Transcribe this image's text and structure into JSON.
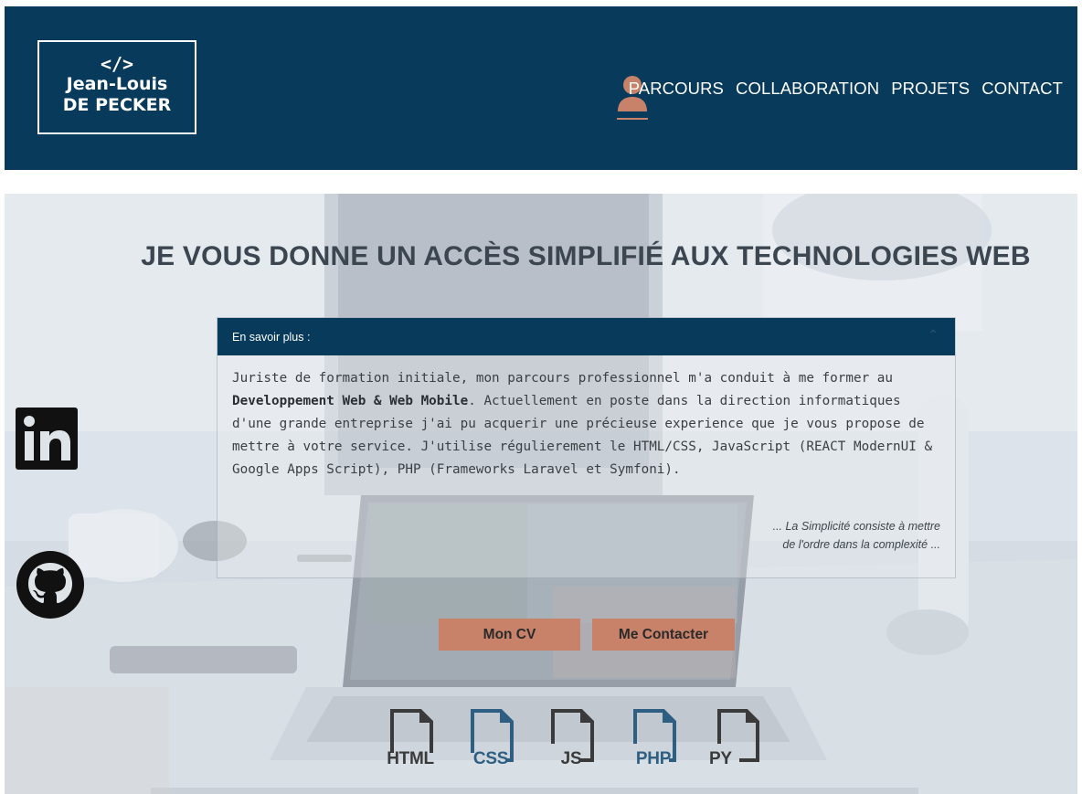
{
  "header": {
    "logo_code": "</>",
    "logo_name_line1": "Jean-Louis",
    "logo_name_line2": "DE PECKER",
    "nav": [
      "PARCOURS",
      "COLLABORATION",
      "PROJETS",
      "CONTACT"
    ],
    "profile_icon": "user-icon"
  },
  "hero": {
    "headline": "JE VOUS DONNE UN ACCÈS SIMPLIFIÉ AUX TECHNOLOGIES WEB",
    "panel": {
      "title": "En savoir plus :",
      "body_part1": "Juriste de formation initiale, mon parcours professionnel m'a conduit à me former au",
      "body_bold": "Developpement Web & Web Mobile",
      "body_part2": ". Actuellement en poste dans la direction informatiques d'une grande entreprise j'ai pu acquerir une précieuse experience que je vous propose de mettre à votre service. J'utilise régulierement le HTML/CSS, JavaScript (REACT ModernUI & Google Apps Script), PHP (Frameworks Laravel et Symfoni).",
      "quote_line1": "... La Simplicité consiste à mettre",
      "quote_line2": "de l'ordre dans la complexité ..."
    },
    "buttons": {
      "cv": "Mon CV",
      "contact": "Me Contacter"
    },
    "social": [
      {
        "name": "linkedin-icon"
      },
      {
        "name": "github-icon"
      }
    ],
    "technologies": [
      {
        "label": "HTML",
        "color": "#3a3a3a"
      },
      {
        "label": "CSS",
        "color": "#2e5f82"
      },
      {
        "label": "JS",
        "color": "#3a3a3a"
      },
      {
        "label": "PHP",
        "color": "#2e5f82"
      },
      {
        "label": "PY",
        "color": "#3a3a3a"
      }
    ]
  },
  "colors": {
    "navy": "#083a5c",
    "accent": "#c8826a"
  }
}
